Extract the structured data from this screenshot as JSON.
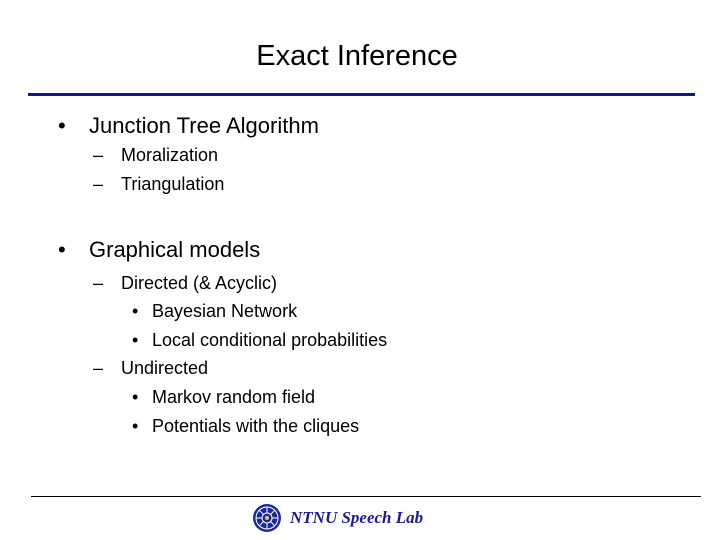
{
  "slide": {
    "title": "Exact Inference",
    "bullets": [
      {
        "text": "Junction Tree Algorithm",
        "marker": "•",
        "children": [
          {
            "text": "Moralization",
            "marker": "–"
          },
          {
            "text": "Triangulation",
            "marker": "–"
          }
        ]
      },
      {
        "text": "Graphical models",
        "marker": "•",
        "children": [
          {
            "text": "Directed (& Acyclic)",
            "marker": "–",
            "children": [
              {
                "text": "Bayesian Network",
                "marker": "•"
              },
              {
                "text": "Local conditional probabilities",
                "marker": "•"
              }
            ]
          },
          {
            "text": "Undirected",
            "marker": "–",
            "children": [
              {
                "text": "Markov random field",
                "marker": "•"
              },
              {
                "text": "Potentials with the cliques",
                "marker": "•"
              }
            ]
          }
        ]
      }
    ]
  },
  "footer": {
    "logo_icon": "ntnu-emblem-icon",
    "text": "NTNU Speech Lab"
  },
  "colors": {
    "title_rule": "#0a1a8a",
    "footer_text": "#1a1a9a"
  }
}
